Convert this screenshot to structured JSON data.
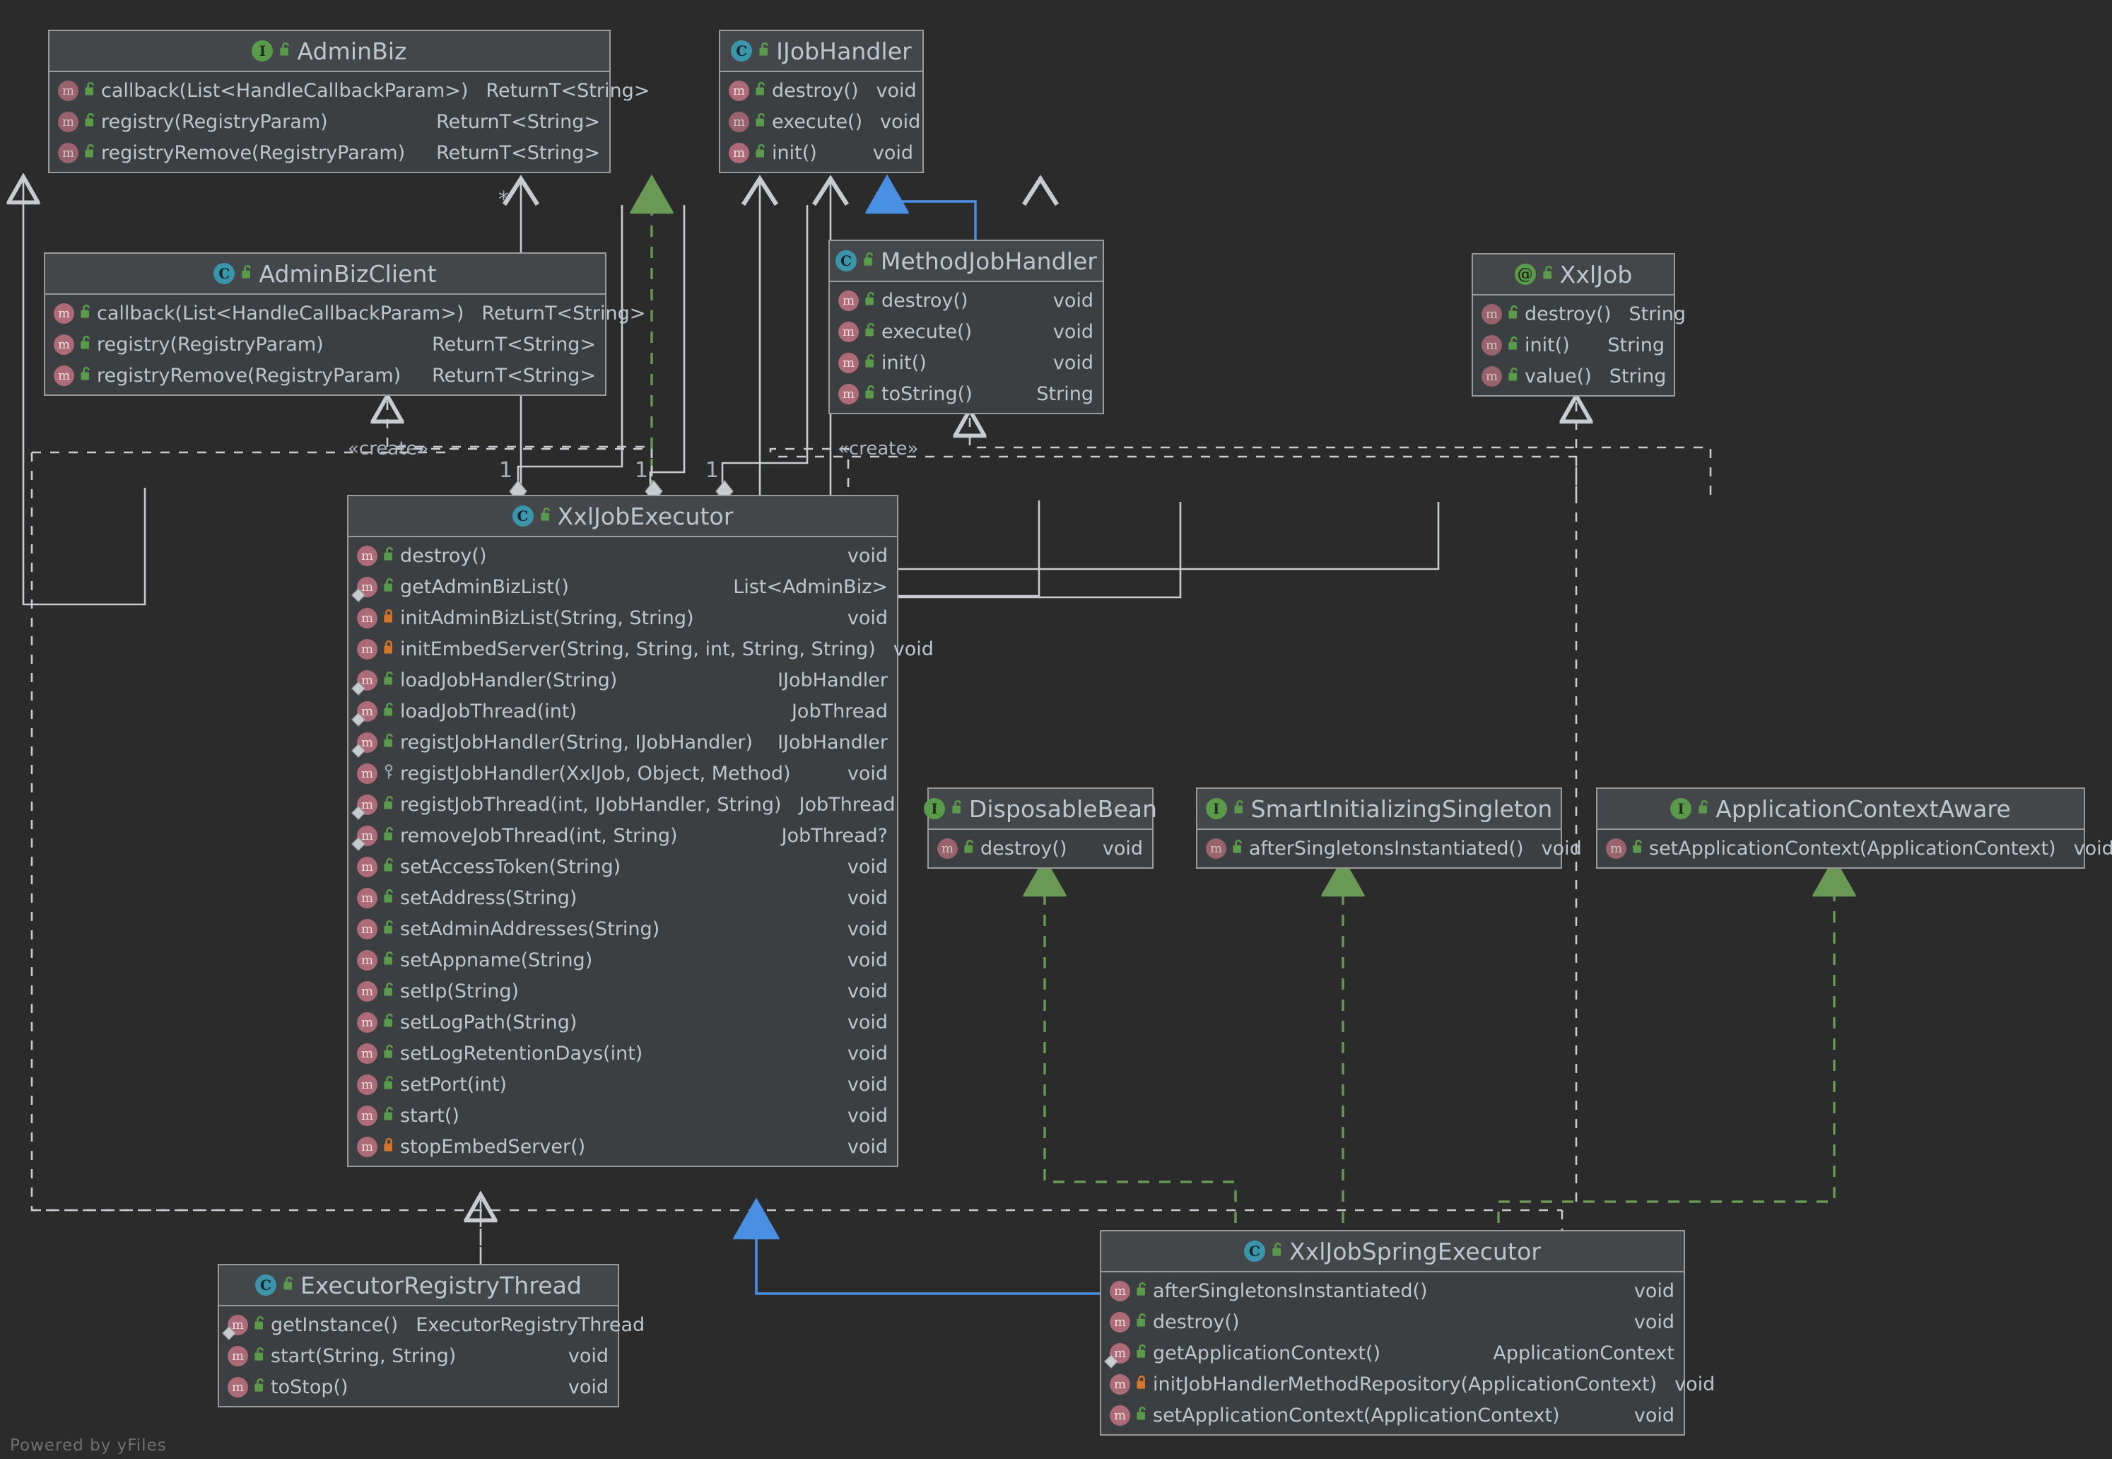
{
  "diagram": {
    "kind": "uml-class-diagram",
    "watermark": "Powered by yFiles",
    "background": "#2b2b2b",
    "colors": {
      "node_fill": "#3c3f41",
      "node_header_fill": "#44474a",
      "node_border": "#9a9a9a",
      "text": "#bcc6cf",
      "interface_icon": "#5a9b4b",
      "class_icon": "#3a95ab",
      "method_icon": "#ad6b77",
      "public_lock": "#5a9b4b",
      "private_lock": "#d4762a",
      "extends_edge": "#4a90e2",
      "implements_edge": "#6a9955",
      "plain_edge": "#c8ccd0"
    }
  },
  "nodes": {
    "adminBiz": {
      "name": "AdminBiz",
      "stereotype": "interface",
      "icon": "interface-icon",
      "visibility": "public",
      "members": [
        {
          "name": "callback(List<HandleCallbackParam>)",
          "type": "ReturnT<String>",
          "icon": "method-icon",
          "abstract": true,
          "visibility": "public"
        },
        {
          "name": "registry(RegistryParam)",
          "type": "ReturnT<String>",
          "icon": "method-icon",
          "abstract": true,
          "visibility": "public"
        },
        {
          "name": "registryRemove(RegistryParam)",
          "type": "ReturnT<String>",
          "icon": "method-icon",
          "abstract": true,
          "visibility": "public"
        }
      ]
    },
    "iJobHandler": {
      "name": "IJobHandler",
      "stereotype": "abstract-class",
      "icon": "class-icon",
      "visibility": "public",
      "members": [
        {
          "name": "destroy()",
          "type": "void",
          "icon": "method-icon",
          "abstract": false,
          "visibility": "public"
        },
        {
          "name": "execute()",
          "type": "void",
          "icon": "method-icon",
          "abstract": true,
          "visibility": "public"
        },
        {
          "name": "init()",
          "type": "void",
          "icon": "method-icon",
          "abstract": false,
          "visibility": "public"
        }
      ]
    },
    "adminBizClient": {
      "name": "AdminBizClient",
      "stereotype": "class",
      "icon": "class-icon",
      "visibility": "public",
      "members": [
        {
          "name": "callback(List<HandleCallbackParam>)",
          "type": "ReturnT<String>",
          "icon": "method-icon",
          "abstract": false,
          "visibility": "public"
        },
        {
          "name": "registry(RegistryParam)",
          "type": "ReturnT<String>",
          "icon": "method-icon",
          "abstract": false,
          "visibility": "public"
        },
        {
          "name": "registryRemove(RegistryParam)",
          "type": "ReturnT<String>",
          "icon": "method-icon",
          "abstract": false,
          "visibility": "public"
        }
      ]
    },
    "methodJobHandler": {
      "name": "MethodJobHandler",
      "stereotype": "class",
      "icon": "class-icon",
      "visibility": "public",
      "members": [
        {
          "name": "destroy()",
          "type": "void",
          "icon": "method-icon",
          "abstract": false,
          "visibility": "public"
        },
        {
          "name": "execute()",
          "type": "void",
          "icon": "method-icon",
          "abstract": false,
          "visibility": "public"
        },
        {
          "name": "init()",
          "type": "void",
          "icon": "method-icon",
          "abstract": false,
          "visibility": "public"
        },
        {
          "name": "toString()",
          "type": "String",
          "icon": "method-icon",
          "abstract": false,
          "visibility": "public"
        }
      ]
    },
    "xxlJob": {
      "name": "XxlJob",
      "stereotype": "annotation",
      "icon": "annotation-icon",
      "visibility": "public",
      "members": [
        {
          "name": "destroy()",
          "type": "String",
          "icon": "method-icon",
          "abstract": true,
          "visibility": "public"
        },
        {
          "name": "init()",
          "type": "String",
          "icon": "method-icon",
          "abstract": true,
          "visibility": "public"
        },
        {
          "name": "value()",
          "type": "String",
          "icon": "method-icon",
          "abstract": true,
          "visibility": "public"
        }
      ]
    },
    "xxlJobExecutor": {
      "name": "XxlJobExecutor",
      "stereotype": "class",
      "icon": "class-icon",
      "visibility": "public",
      "members": [
        {
          "name": "destroy()",
          "type": "void",
          "icon": "method-icon",
          "abstract": false,
          "visibility": "public",
          "overrides": false
        },
        {
          "name": "getAdminBizList()",
          "type": "List<AdminBiz>",
          "icon": "method-icon",
          "abstract": false,
          "visibility": "public",
          "overrides": true
        },
        {
          "name": "initAdminBizList(String, String)",
          "type": "void",
          "icon": "method-icon",
          "abstract": false,
          "visibility": "private",
          "overrides": false
        },
        {
          "name": "initEmbedServer(String, String, int, String, String)",
          "type": "void",
          "icon": "method-icon",
          "abstract": false,
          "visibility": "private",
          "overrides": false
        },
        {
          "name": "loadJobHandler(String)",
          "type": "IJobHandler",
          "icon": "method-icon",
          "abstract": false,
          "visibility": "public",
          "overrides": true
        },
        {
          "name": "loadJobThread(int)",
          "type": "JobThread",
          "icon": "method-icon",
          "abstract": false,
          "visibility": "public",
          "overrides": true
        },
        {
          "name": "registJobHandler(String, IJobHandler)",
          "type": "IJobHandler",
          "icon": "method-icon",
          "abstract": false,
          "visibility": "public",
          "overrides": true
        },
        {
          "name": "registJobHandler(XxlJob, Object, Method)",
          "type": "void",
          "icon": "method-icon",
          "abstract": false,
          "visibility": "package",
          "overrides": false
        },
        {
          "name": "registJobThread(int, IJobHandler, String)",
          "type": "JobThread",
          "icon": "method-icon",
          "abstract": false,
          "visibility": "public",
          "overrides": true
        },
        {
          "name": "removeJobThread(int, String)",
          "type": "JobThread?",
          "icon": "method-icon",
          "abstract": false,
          "visibility": "public",
          "overrides": true
        },
        {
          "name": "setAccessToken(String)",
          "type": "void",
          "icon": "method-icon",
          "abstract": false,
          "visibility": "public",
          "overrides": false
        },
        {
          "name": "setAddress(String)",
          "type": "void",
          "icon": "method-icon",
          "abstract": false,
          "visibility": "public",
          "overrides": false
        },
        {
          "name": "setAdminAddresses(String)",
          "type": "void",
          "icon": "method-icon",
          "abstract": false,
          "visibility": "public",
          "overrides": false
        },
        {
          "name": "setAppname(String)",
          "type": "void",
          "icon": "method-icon",
          "abstract": false,
          "visibility": "public",
          "overrides": false
        },
        {
          "name": "setIp(String)",
          "type": "void",
          "icon": "method-icon",
          "abstract": false,
          "visibility": "public",
          "overrides": false
        },
        {
          "name": "setLogPath(String)",
          "type": "void",
          "icon": "method-icon",
          "abstract": false,
          "visibility": "public",
          "overrides": false
        },
        {
          "name": "setLogRetentionDays(int)",
          "type": "void",
          "icon": "method-icon",
          "abstract": false,
          "visibility": "public",
          "overrides": false
        },
        {
          "name": "setPort(int)",
          "type": "void",
          "icon": "method-icon",
          "abstract": false,
          "visibility": "public",
          "overrides": false
        },
        {
          "name": "start()",
          "type": "void",
          "icon": "method-icon",
          "abstract": false,
          "visibility": "public",
          "overrides": false
        },
        {
          "name": "stopEmbedServer()",
          "type": "void",
          "icon": "method-icon",
          "abstract": false,
          "visibility": "private",
          "overrides": false
        }
      ]
    },
    "disposableBean": {
      "name": "DisposableBean",
      "stereotype": "interface",
      "icon": "interface-icon",
      "visibility": "public",
      "members": [
        {
          "name": "destroy()",
          "type": "void",
          "icon": "method-icon",
          "abstract": true,
          "visibility": "public"
        }
      ]
    },
    "smartInitializingSingleton": {
      "name": "SmartInitializingSingleton",
      "stereotype": "interface",
      "icon": "interface-icon",
      "visibility": "public",
      "members": [
        {
          "name": "afterSingletonsInstantiated()",
          "type": "void",
          "icon": "method-icon",
          "abstract": true,
          "visibility": "public"
        }
      ]
    },
    "applicationContextAware": {
      "name": "ApplicationContextAware",
      "stereotype": "interface",
      "icon": "interface-icon",
      "visibility": "public",
      "members": [
        {
          "name": "setApplicationContext(ApplicationContext)",
          "type": "void",
          "icon": "method-icon",
          "abstract": true,
          "visibility": "public"
        }
      ]
    },
    "executorRegistryThread": {
      "name": "ExecutorRegistryThread",
      "stereotype": "class",
      "icon": "class-icon",
      "visibility": "public",
      "members": [
        {
          "name": "getInstance()",
          "type": "ExecutorRegistryThread",
          "icon": "method-icon",
          "abstract": false,
          "visibility": "public",
          "overrides": true
        },
        {
          "name": "start(String, String)",
          "type": "void",
          "icon": "method-icon",
          "abstract": false,
          "visibility": "public",
          "overrides": false
        },
        {
          "name": "toStop()",
          "type": "void",
          "icon": "method-icon",
          "abstract": false,
          "visibility": "public",
          "overrides": false
        }
      ]
    },
    "xxlJobSpringExecutor": {
      "name": "XxlJobSpringExecutor",
      "stereotype": "class",
      "icon": "class-icon",
      "visibility": "public",
      "members": [
        {
          "name": "afterSingletonsInstantiated()",
          "type": "void",
          "icon": "method-icon",
          "abstract": false,
          "visibility": "public",
          "overrides": false
        },
        {
          "name": "destroy()",
          "type": "void",
          "icon": "method-icon",
          "abstract": false,
          "visibility": "public",
          "overrides": false
        },
        {
          "name": "getApplicationContext()",
          "type": "ApplicationContext",
          "icon": "method-icon",
          "abstract": false,
          "visibility": "public",
          "overrides": true
        },
        {
          "name": "initJobHandlerMethodRepository(ApplicationContext)",
          "type": "void",
          "icon": "method-icon",
          "abstract": false,
          "visibility": "private",
          "overrides": false
        },
        {
          "name": "setApplicationContext(ApplicationContext)",
          "type": "void",
          "icon": "method-icon",
          "abstract": false,
          "visibility": "public",
          "overrides": false
        }
      ]
    }
  },
  "edge_labels": [
    {
      "id": "create-left",
      "text": "«create»"
    },
    {
      "id": "create-right",
      "text": "«create»"
    },
    {
      "id": "mult-star",
      "text": "*"
    },
    {
      "id": "mult-one-a",
      "text": "1"
    },
    {
      "id": "mult-one-b",
      "text": "1"
    },
    {
      "id": "mult-one-c",
      "text": "1"
    }
  ]
}
